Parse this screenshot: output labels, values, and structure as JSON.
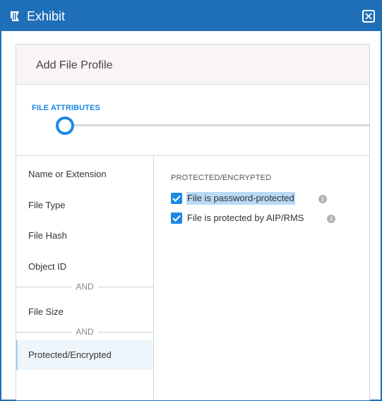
{
  "window": {
    "title": "Exhibit",
    "colors": {
      "titlebar": "#1f6fb8",
      "accent": "#1e88e5"
    },
    "icons": {
      "title": "app-logo-icon",
      "close": "close-icon"
    }
  },
  "panel": {
    "title": "Add File Profile"
  },
  "attributes": {
    "section_label": "FILE ATTRIBUTES"
  },
  "nav": {
    "items": [
      {
        "label": "Name or Extension"
      },
      {
        "label": "File Type"
      },
      {
        "label": "File Hash"
      },
      {
        "label": "Object ID"
      },
      {
        "label": "File Size"
      },
      {
        "label": "Protected/Encrypted",
        "selected": true
      }
    ],
    "dividers": [
      "AND",
      "AND"
    ]
  },
  "detail": {
    "heading": "PROTECTED/ENCRYPTED",
    "options": [
      {
        "label": "File is password-protected",
        "checked": true,
        "info_icon": "info-icon"
      },
      {
        "label": "File is protected by AIP/RMS",
        "checked": true,
        "info_icon": "info-icon"
      }
    ]
  }
}
